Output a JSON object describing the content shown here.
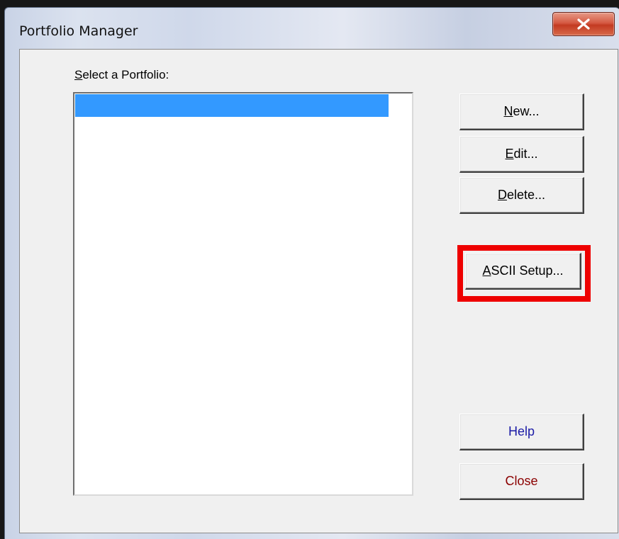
{
  "window": {
    "title": "Portfolio Manager"
  },
  "main": {
    "select_label_prefix": "S",
    "select_label_rest": "elect a Portfolio:",
    "portfolios": [
      ""
    ]
  },
  "buttons": {
    "new": {
      "underline": "N",
      "rest": "ew..."
    },
    "edit": {
      "underline": "E",
      "rest": "dit..."
    },
    "delete": {
      "underline": "D",
      "rest": "elete..."
    },
    "ascii": {
      "underline": "A",
      "rest": "SCII Setup..."
    },
    "help": "Help",
    "close": "Close"
  },
  "colors": {
    "selection": "#3399ff",
    "highlight": "#ee0000",
    "help_text": "#1a1aa6",
    "close_text": "#8b0000"
  }
}
